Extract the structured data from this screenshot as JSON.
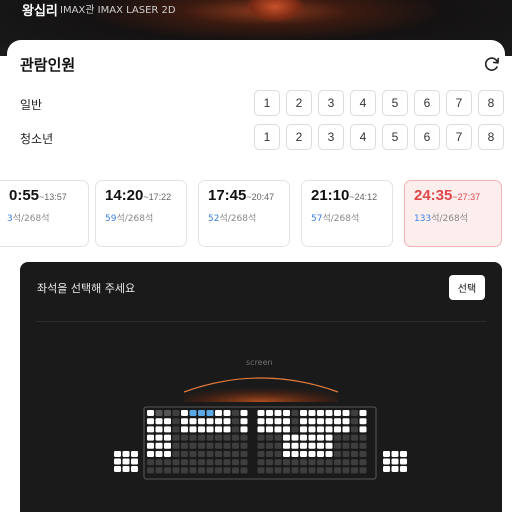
{
  "header": {
    "theater": "왕십리",
    "hall": "IMAX관 IMAX LASER 2D"
  },
  "audience": {
    "title": "관람인원",
    "refresh_icon": "refresh-icon",
    "rows": [
      {
        "label": "일반",
        "counts": [
          "1",
          "2",
          "3",
          "4",
          "5",
          "6",
          "7",
          "8"
        ]
      },
      {
        "label": "청소년",
        "counts": [
          "1",
          "2",
          "3",
          "4",
          "5",
          "6",
          "7",
          "8"
        ]
      }
    ]
  },
  "showtimes": [
    {
      "start": "0:55",
      "end": "~13:57",
      "available": "3",
      "total": "석/268석",
      "selected": false
    },
    {
      "start": "14:20",
      "end": "~17:22",
      "available": "59",
      "total": "석/268석",
      "selected": false
    },
    {
      "start": "17:45",
      "end": "~20:47",
      "available": "52",
      "total": "석/268석",
      "selected": false
    },
    {
      "start": "21:10",
      "end": "~24:12",
      "available": "57",
      "total": "석/268석",
      "selected": false
    },
    {
      "start": "24:35",
      "end": "~27:37",
      "available": "133",
      "total": "석/268석",
      "selected": true
    }
  ],
  "seat_selection": {
    "title": "좌석을 선택해 주세요",
    "select_button": "선택",
    "screen_label": "screen"
  },
  "colors": {
    "accent_red": "#e0464a",
    "available_blue": "#3b82e0",
    "seat_available": "#ffffff",
    "seat_taken": "#3e3e3e",
    "seat_selected": "#5aa9e8",
    "panel_bg": "#1a1a1a"
  }
}
